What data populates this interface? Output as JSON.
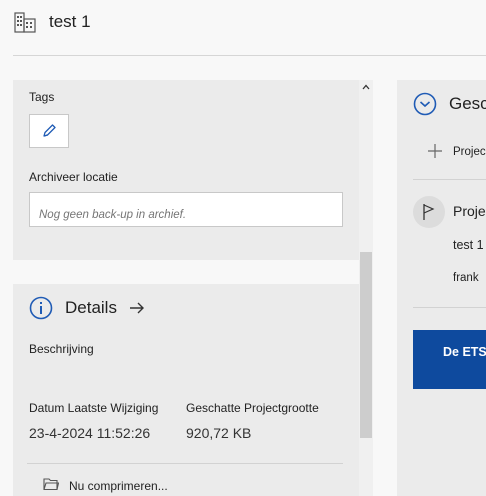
{
  "header": {
    "title": "test 1",
    "icon": "building-icon"
  },
  "properties": {
    "tags_label": "Tags",
    "edit_icon": "pencil-icon",
    "archive_label": "Archiveer locatie",
    "archive_placeholder": "Nog geen back-up in archief."
  },
  "details": {
    "title": "Details",
    "description_label": "Beschrijving",
    "last_modified_label": "Datum Laatste Wijziging",
    "last_modified_value": "23-4-2024 11:52:26",
    "size_label": "Geschatte Projectgrootte",
    "size_value": "920,72 KB",
    "compress_label": "Nu comprimeren..."
  },
  "history": {
    "title": "Gesc",
    "add_label": "Projec",
    "entry_label": "Proje",
    "entry_project": "test 1",
    "entry_user": "frank",
    "banner_text": "De ETS"
  },
  "colors": {
    "accent": "#0e4a9e",
    "panel_bg": "#ebebeb",
    "page_bg": "#f8f8f8"
  }
}
